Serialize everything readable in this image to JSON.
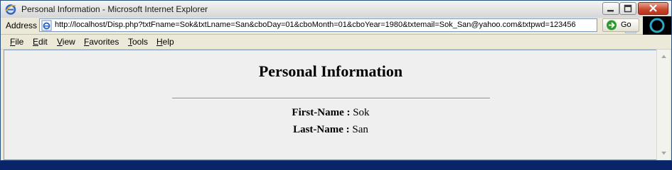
{
  "window": {
    "title": "Personal Information - Microsoft Internet Explorer"
  },
  "address_bar": {
    "label": "Address",
    "url": "http://localhost/Disp.php?txtFname=Sok&txtLname=San&cboDay=01&cboMonth=01&cboYear=1980&txtemail=Sok_San@yahoo.com&txtpwd=123456",
    "go_label": "Go"
  },
  "menu": {
    "items": [
      "File",
      "Edit",
      "View",
      "Favorites",
      "Tools",
      "Help"
    ]
  },
  "page": {
    "heading": "Personal Information",
    "fields": [
      {
        "label": "First-Name :",
        "value": "Sok"
      },
      {
        "label": "Last-Name :",
        "value": "San"
      }
    ]
  },
  "icons": {
    "app": "ie-logo-icon",
    "page": "ie-page-icon",
    "go": "green-arrow-icon",
    "dropdown": "chevron-down-icon",
    "minimize": "minimize-icon",
    "maximize": "maximize-icon",
    "close": "close-icon"
  },
  "colors": {
    "content_bg": "#efefef",
    "chrome_bg": "#ece9d8",
    "close_button": "#c9452b",
    "go_arrow": "#2d9a2d"
  }
}
